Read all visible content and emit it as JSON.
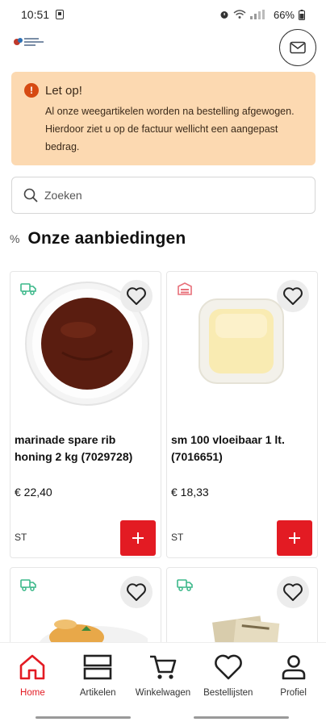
{
  "status_bar": {
    "time": "10:51",
    "battery": "66%",
    "battery_icon": "battery-icon",
    "wifi_icon": "wifi-icon",
    "signal_icon": "signal-icon",
    "alarm_icon": "alarm-icon"
  },
  "header": {
    "mail_icon": "mail-icon"
  },
  "alert": {
    "title": "Let op!",
    "text": "Al onze weegartikelen worden na bestelling afgewogen. Hierdoor ziet u op de factuur wellicht een aangepast bedrag.",
    "icon": "alert-icon",
    "color": "#fcd9b1"
  },
  "search": {
    "placeholder": "Zoeken"
  },
  "offers": {
    "title": "Onze aanbiedingen",
    "icon": "percent-icon",
    "products": [
      {
        "name": "marinade spare rib honing 2 kg (7029728)",
        "price": "€ 22,40",
        "unit": "ST",
        "type_icon": "delivery-truck-icon",
        "image": "bbq-sauce-bowl-image"
      },
      {
        "name": "sm 100 vloeibaar 1 lt. (7016651)",
        "price": "€ 18,33",
        "unit": "ST",
        "type_icon": "warehouse-icon",
        "image": "liquid-butter-tray-image"
      },
      {
        "name": "",
        "price": "",
        "unit": "",
        "type_icon": "delivery-truck-icon",
        "image": "pasta-dish-image"
      },
      {
        "name": "",
        "price": "",
        "unit": "",
        "type_icon": "delivery-truck-icon",
        "image": "packaged-product-image"
      }
    ]
  },
  "bottom_nav": {
    "items": [
      {
        "label": "Home",
        "icon": "home-icon",
        "active": true
      },
      {
        "label": "Artikelen",
        "icon": "list-icon",
        "active": false
      },
      {
        "label": "Winkelwagen",
        "icon": "cart-icon",
        "active": false
      },
      {
        "label": "Bestellijsten",
        "icon": "heart-icon",
        "active": false
      },
      {
        "label": "Profiel",
        "icon": "user-icon",
        "active": false
      }
    ]
  },
  "colors": {
    "accent": "#e31b23",
    "alert_bg": "#fcd9b1",
    "alert_icon": "#d64a12",
    "truck_icon": "#3cb88a",
    "warehouse_icon": "#e8707a"
  }
}
